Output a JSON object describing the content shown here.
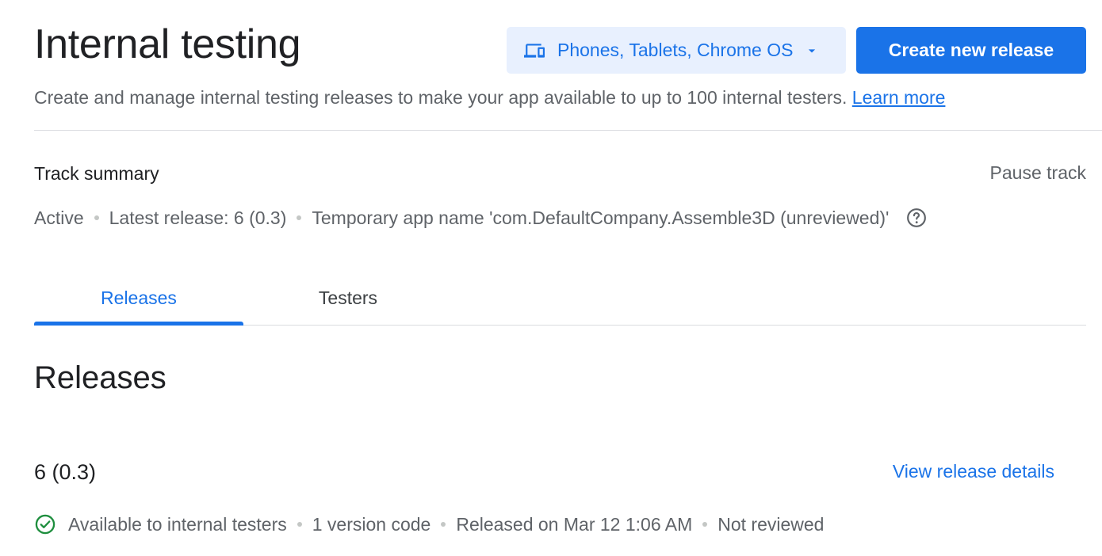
{
  "header": {
    "title": "Internal testing",
    "device_selector": {
      "label": "Phones, Tablets, Chrome OS",
      "icon": "devices-icon"
    },
    "create_button": "Create new release",
    "subtitle": "Create and manage internal testing releases to make your app available to up to 100 internal testers.",
    "learn_more": "Learn more"
  },
  "track": {
    "heading": "Track summary",
    "pause_label": "Pause track",
    "status": "Active",
    "latest_release": "Latest release: 6 (0.3)",
    "app_name_note": "Temporary app name 'com.DefaultCompany.Assemble3D (unreviewed)'"
  },
  "tabs": [
    {
      "label": "Releases",
      "active": true
    },
    {
      "label": "Testers",
      "active": false
    }
  ],
  "releases": {
    "heading": "Releases",
    "items": [
      {
        "version": "6 (0.3)",
        "view_details": "View release details",
        "availability": "Available to internal testers",
        "version_codes": "1 version code",
        "released_on": "Released on Mar 12 1:06 AM",
        "review_status": "Not reviewed"
      }
    ]
  },
  "colors": {
    "accent": "#1a73e8",
    "accent_light": "#e8f0fe",
    "success": "#1e8e3e",
    "muted_text": "#5f6368",
    "divider": "#dadce0"
  }
}
